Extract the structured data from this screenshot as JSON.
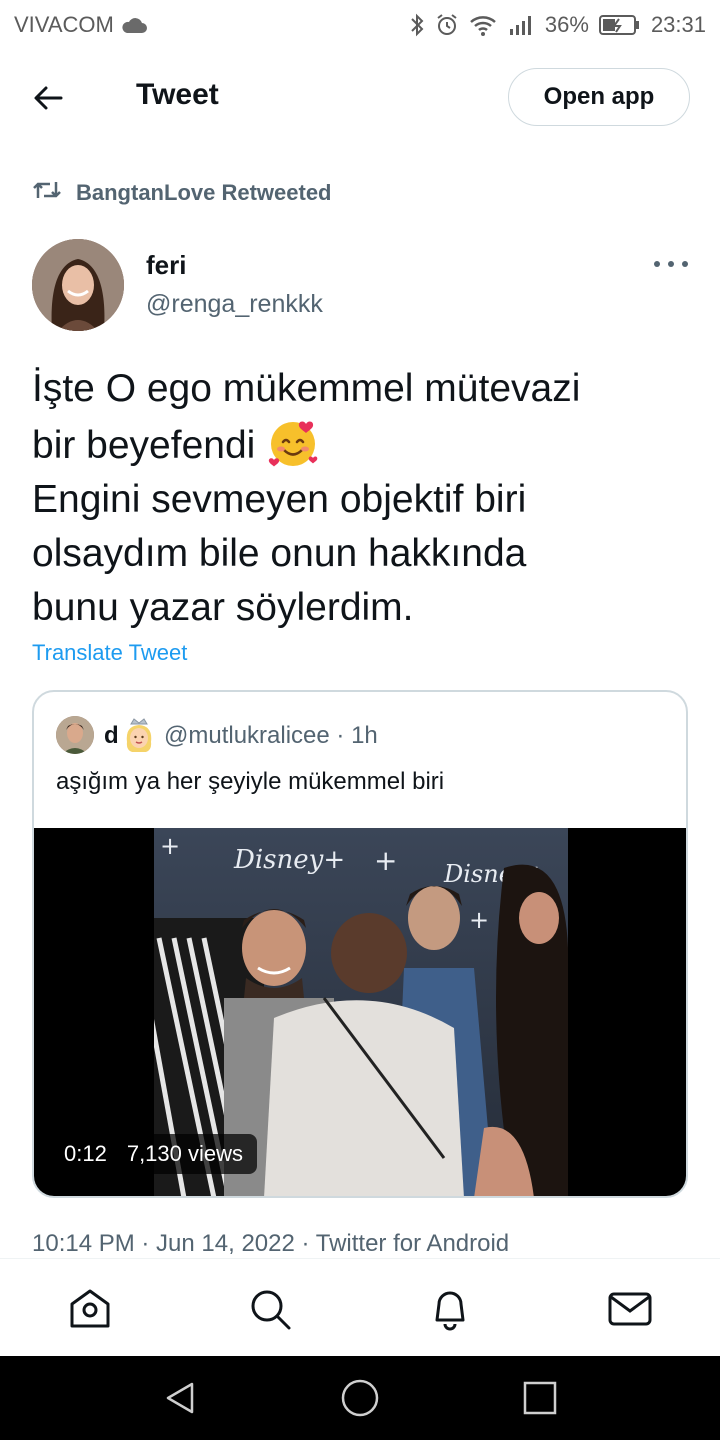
{
  "status_bar": {
    "carrier": "VIVACOM",
    "battery": "36%",
    "time": "23:31",
    "icons": [
      "cloud-icon",
      "bluetooth-icon",
      "alarm-icon",
      "wifi-icon",
      "signal-icon",
      "battery-icon"
    ]
  },
  "header": {
    "title": "Tweet",
    "open_app": "Open app"
  },
  "retweet": {
    "label": "BangtanLove Retweeted"
  },
  "author": {
    "name": "feri",
    "handle": "@renga_renkkk"
  },
  "tweet": {
    "line1": "İşte O ego mükemmel mütevazi",
    "line2": "bir beyefendi",
    "line3": "Engini sevmeyen objektif biri",
    "line4": "olsaydım bile onun hakkında",
    "line5": "bunu yazar söylerdim.",
    "emoji": "smiling-face-with-hearts",
    "translate": "Translate Tweet"
  },
  "quote": {
    "name": "d",
    "handle_time": "@mutlukralicee · 1h",
    "text": "aşığım ya her şeyiyle mükemmel biri",
    "video": {
      "duration": "0:12",
      "views": "7,130 views"
    }
  },
  "meta": {
    "line": "10:14 PM · Jun 14, 2022 · Twitter for Android"
  },
  "colors": {
    "accent": "#1d9bf0",
    "text": "#0f1419",
    "secondary": "#536471",
    "border": "#cfd9de"
  }
}
